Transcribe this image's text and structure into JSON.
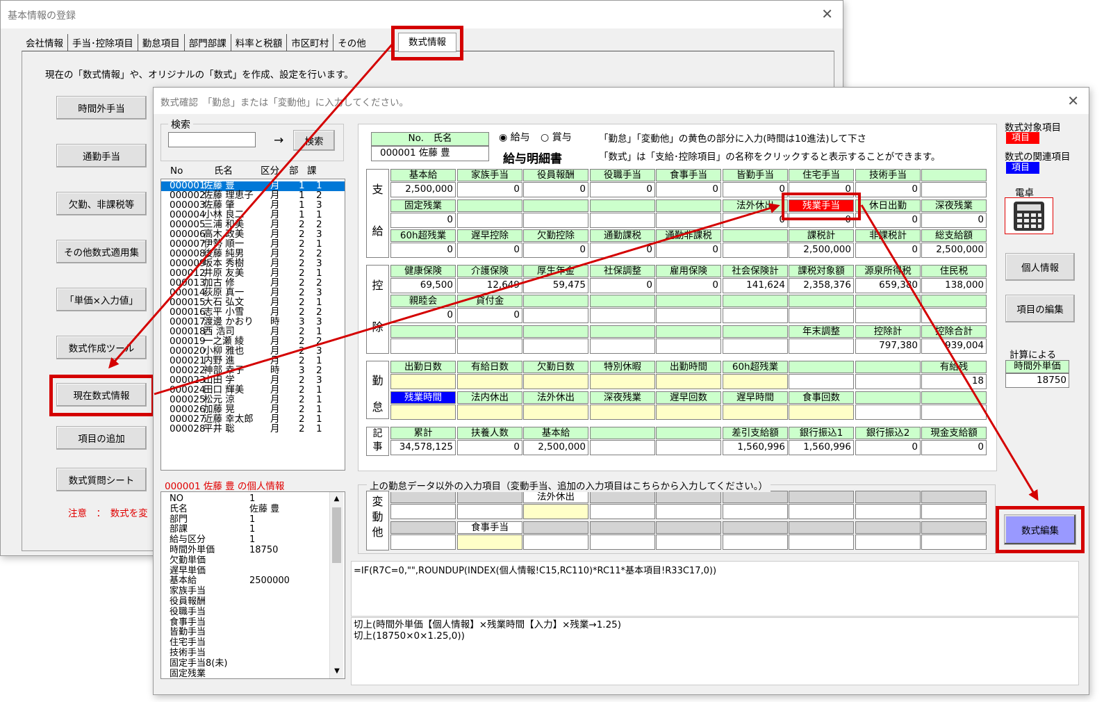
{
  "back_window": {
    "title": "基本情報の登録",
    "tabs": [
      "会社情報",
      "手当･控除項目",
      "勤怠項目",
      "部門部課",
      "料率と税額",
      "市区町村",
      "その他",
      "数式情報"
    ],
    "description": "現在の「数式情報」や、オリジナルの「数式」を作成、設定を行います。",
    "buttons": [
      "時間外手当",
      "通勤手当",
      "欠勤、非課税等",
      "その他数式適用集",
      "「単価×入力値」",
      "数式作成ツール",
      "現在数式情報",
      "項目の追加",
      "数式質問シート"
    ],
    "note": "注意　：　数式を変"
  },
  "dialog": {
    "title": "数式確認　「勤怠」または「変動他」に入力してください。",
    "search": {
      "group_label": "検索",
      "arrow": "→",
      "button": "検索",
      "value": ""
    },
    "list_headers": [
      "No",
      "氏名",
      "区分",
      "部",
      "課"
    ],
    "employees": [
      [
        "000001",
        "佐藤 豊",
        "月",
        "1",
        "1"
      ],
      [
        "000002",
        "佐藤 理恵子",
        "月",
        "1",
        "2"
      ],
      [
        "000003",
        "佐藤 肇",
        "月",
        "1",
        "3"
      ],
      [
        "000004",
        "小林 良二",
        "月",
        "1",
        "1"
      ],
      [
        "000005",
        "三浦 和美",
        "月",
        "2",
        "2"
      ],
      [
        "000006",
        "高木 政美",
        "月",
        "2",
        "3"
      ],
      [
        "000007",
        "伊勢 順一",
        "月",
        "2",
        "1"
      ],
      [
        "000008",
        "後藤 純男",
        "月",
        "2",
        "2"
      ],
      [
        "000009",
        "坂本 秀樹",
        "月",
        "2",
        "3"
      ],
      [
        "000012",
        "井原 友美",
        "月",
        "2",
        "1"
      ],
      [
        "000013",
        "加古 修",
        "月",
        "2",
        "2"
      ],
      [
        "000014",
        "荻原 真一",
        "月",
        "2",
        "3"
      ],
      [
        "000015",
        "大石 弘文",
        "月",
        "2",
        "1"
      ],
      [
        "000016",
        "志平 小雪",
        "月",
        "2",
        "2"
      ],
      [
        "000017",
        "渡邊 かおり",
        "時",
        "3",
        "3"
      ],
      [
        "000018",
        "西 浩司",
        "月",
        "2",
        "1"
      ],
      [
        "000019",
        "一之瀬 綾",
        "月",
        "2",
        "2"
      ],
      [
        "000020",
        "小柳 雅也",
        "月",
        "2",
        "3"
      ],
      [
        "000021",
        "内野 進",
        "月",
        "2",
        "1"
      ],
      [
        "000022",
        "神部 幸子",
        "時",
        "3",
        "2"
      ],
      [
        "000023",
        "山田 学",
        "月",
        "2",
        "3"
      ],
      [
        "000024",
        "田口 輝美",
        "月",
        "2",
        "1"
      ],
      [
        "000025",
        "松元 涼",
        "月",
        "2",
        "1"
      ],
      [
        "000026",
        "加藤 晃",
        "月",
        "2",
        "1"
      ],
      [
        "000027",
        "近藤 幸太郎",
        "月",
        "2",
        "1"
      ],
      [
        "000028",
        "平井 聡",
        "月",
        "2",
        "1"
      ]
    ],
    "info_title": "000001 佐藤 豊 の個人情報",
    "info_rows": [
      [
        "NO",
        "1"
      ],
      [
        "氏名",
        "佐藤 豊"
      ],
      [
        "部門",
        "1"
      ],
      [
        "部課",
        "1"
      ],
      [
        "給与区分",
        "1"
      ],
      [
        "時間外単価",
        "18750"
      ],
      [
        "欠勤単価",
        ""
      ],
      [
        "遅早単価",
        ""
      ],
      [
        "基本給",
        "2500000"
      ],
      [
        "家族手当",
        ""
      ],
      [
        "役員報酬",
        ""
      ],
      [
        "役職手当",
        ""
      ],
      [
        "食事手当",
        ""
      ],
      [
        "皆勤手当",
        ""
      ],
      [
        "住宅手当",
        ""
      ],
      [
        "技術手当",
        ""
      ],
      [
        "固定手当8(未)",
        ""
      ],
      [
        "固定残業",
        ""
      ]
    ],
    "slip": {
      "no_header": "No.　氏名",
      "no_value": "000001 佐藤 豊",
      "radio1": "給与",
      "radio2": "賞与",
      "slip_title": "給与明細書",
      "instr1": "「勤怠」「変動他」の黄色の部分に入力(時間は10進法)して下さ",
      "instr2": "「数式」は「支給･控除項目」の名称をクリックすると表示することができます。",
      "side_labels": [
        "支",
        "給",
        "控",
        "除",
        "勤",
        "怠",
        "記",
        "事"
      ],
      "pay_h1": [
        "基本給",
        "家族手当",
        "役員報酬",
        "役職手当",
        "食事手当",
        "皆勤手当",
        "住宅手当",
        "技術手当",
        ""
      ],
      "pay_v1": [
        "2,500,000",
        "0",
        "0",
        "0",
        "0",
        "0",
        "0",
        "0",
        ""
      ],
      "pay_h2": [
        "固定残業",
        "",
        "",
        "",
        "",
        "法外休出",
        "残業手当",
        "休日出勤",
        "深夜残業"
      ],
      "pay_v2": [
        "0",
        "",
        "",
        "",
        "",
        "0",
        "0",
        "0",
        "0"
      ],
      "pay_h3": [
        "60h超残業",
        "遅早控除",
        "欠勤控除",
        "通勤課税",
        "通勤非課税",
        "",
        "課税計",
        "非課税計",
        "総支給額"
      ],
      "pay_v3": [
        "0",
        "0",
        "0",
        "0",
        "0",
        "",
        "2,500,000",
        "0",
        "2,500,000"
      ],
      "ded_h1": [
        "健康保険",
        "介護保険",
        "厚生年金",
        "社保調整",
        "雇用保険",
        "社会保険計",
        "課税対象額",
        "源泉所得税",
        "住民税"
      ],
      "ded_v1": [
        "69,500",
        "12,649",
        "59,475",
        "0",
        "0",
        "141,624",
        "2,358,376",
        "659,380",
        "138,000"
      ],
      "ded_h2": [
        "親睦会",
        "貸付金",
        "",
        "",
        "",
        "",
        "",
        "",
        ""
      ],
      "ded_v2": [
        "0",
        "0",
        "",
        "",
        "",
        "",
        "",
        "",
        ""
      ],
      "ded_h3": [
        "",
        "",
        "",
        "",
        "",
        "",
        "年末調整",
        "控除計",
        "控除合計"
      ],
      "ded_v3": [
        "",
        "",
        "",
        "",
        "",
        "",
        "",
        "797,380",
        "939,004"
      ],
      "att_h1": [
        "出勤日数",
        "有給日数",
        "欠勤日数",
        "特別休暇",
        "出勤時間",
        "60h超残業",
        "",
        "",
        "有給残"
      ],
      "att_v1": [
        "",
        "",
        "",
        "",
        "",
        "",
        "",
        "",
        "18"
      ],
      "att_h2": [
        "残業時間",
        "法内休出",
        "法外休出",
        "深夜残業",
        "遅早回数",
        "遅早時間",
        "食事回数",
        "",
        ""
      ],
      "att_v2": [
        "",
        "",
        "",
        "",
        "",
        "",
        "",
        "",
        ""
      ],
      "rec_h": [
        "累計",
        "扶養人数",
        "基本給",
        "",
        "",
        "差引支給額",
        "銀行振込1",
        "銀行振込2",
        "現金支給額"
      ],
      "rec_v": [
        "34,578,125",
        "0",
        "2,500,000",
        "",
        "",
        "1,560,996",
        "1,560,996",
        "0",
        "0"
      ]
    },
    "var_group_label": "上の勤怠データ以外の入力項目（変動手当、追加の入力項目はこちらから入力してください。）",
    "var_side": [
      "変",
      "動",
      "他"
    ],
    "var_h1": [
      "",
      "",
      "法外休出",
      "",
      "",
      "",
      "",
      "",
      ""
    ],
    "var_h2": [
      "",
      "食事手当",
      "",
      "",
      "",
      "",
      "",
      "",
      ""
    ],
    "formula": "=IF(R7C=0,\"\",ROUNDUP(INDEX(個人情報!C15,RC110)*RC11*基本項目!R33C17,0))",
    "explain1": "切上(時間外単価【個人情報】×残業時間【入力】×残業→1.25)",
    "explain2": "切上(18750×0×1.25,0))",
    "legend": {
      "target_label": "数式対象項目",
      "target_chip": "項目",
      "related_label": "数式の関連項目",
      "related_chip": "項目",
      "calc_label": "電卓"
    },
    "right_buttons": [
      "個人情報",
      "項目の編集"
    ],
    "calc_by": "計算による",
    "ot_rate_label": "時間外単価",
    "ot_rate_value": "18750",
    "edit_button": "数式編集"
  },
  "colors": {
    "highlight_red": "#d40000",
    "selection_blue": "#0078d7",
    "header_green": "#ccffcc",
    "input_yellow": "#ffffc8"
  }
}
